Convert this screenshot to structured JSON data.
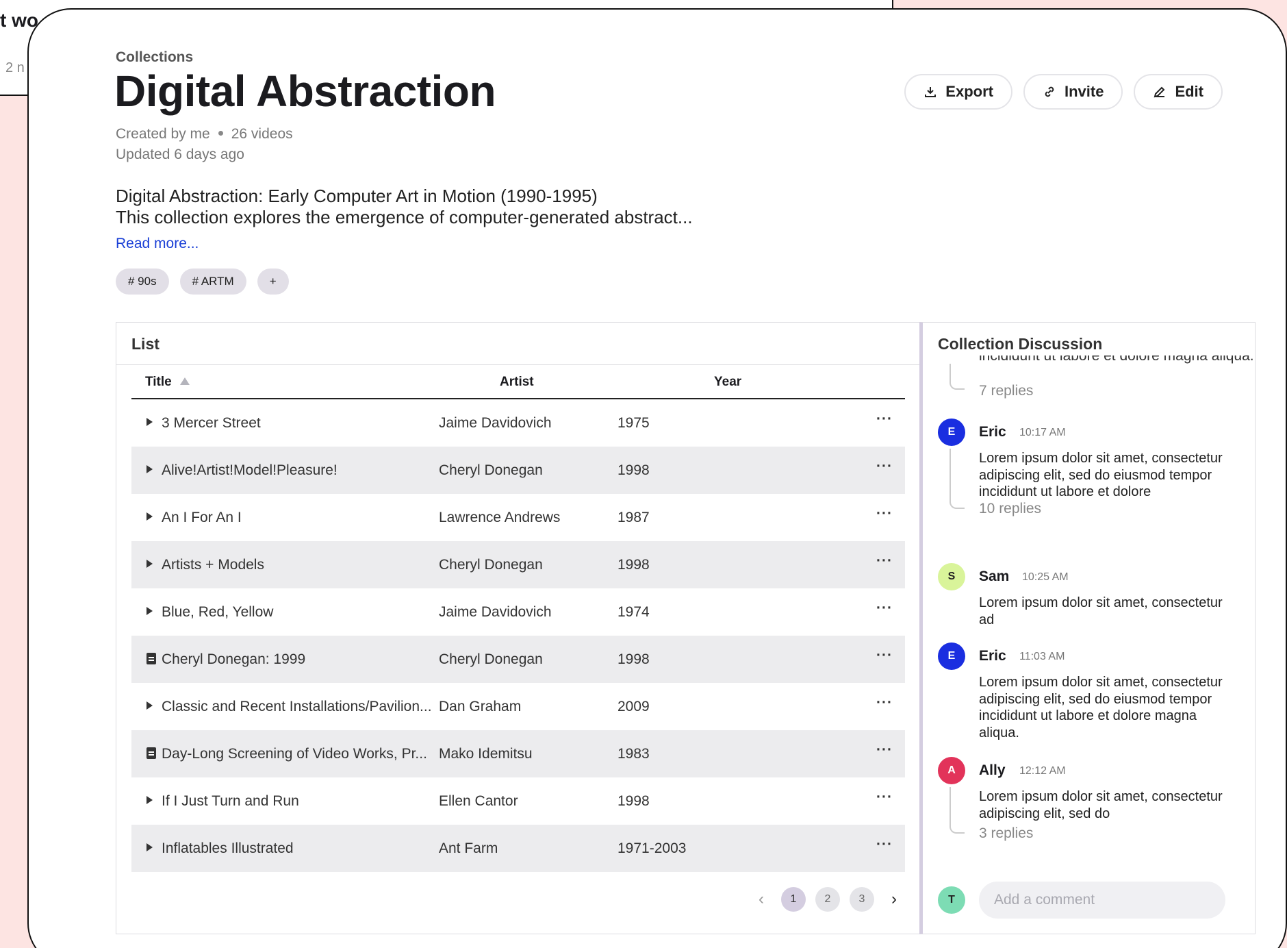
{
  "background": {
    "text1": "t wo",
    "text2": "2 n"
  },
  "breadcrumb": "Collections",
  "title": "Digital Abstraction",
  "meta": {
    "created_by": "Created by me",
    "video_count": "26 videos",
    "updated": "Updated 6 days ago"
  },
  "description": {
    "title": "Digital Abstraction: Early Computer Art in Motion (1990-1995)",
    "body": "This collection explores the emergence of computer-generated abstract...",
    "read_more": "Read more..."
  },
  "tags": [
    "# 90s",
    "# ARTM"
  ],
  "tag_add": "+",
  "actions": {
    "export": "Export",
    "invite": "Invite",
    "edit": "Edit"
  },
  "list": {
    "header": "List",
    "columns": {
      "title": "Title",
      "artist": "Artist",
      "year": "Year"
    },
    "more_label": "···",
    "rows": [
      {
        "title": "3 Mercer Street",
        "artist": "Jaime Davidovich",
        "year": "1975",
        "icon": "play-icon"
      },
      {
        "title": "Alive!Artist!Model!Pleasure!",
        "artist": "Cheryl Donegan",
        "year": "1998",
        "icon": "play-icon"
      },
      {
        "title": "An I For An I",
        "artist": "Lawrence Andrews",
        "year": "1987",
        "icon": "play-icon"
      },
      {
        "title": "Artists + Models",
        "artist": "Cheryl Donegan",
        "year": "1998",
        "icon": "play-icon"
      },
      {
        "title": "Blue, Red, Yellow",
        "artist": "Jaime Davidovich",
        "year": "1974",
        "icon": "play-icon"
      },
      {
        "title": "Cheryl Donegan: 1999",
        "artist": "Cheryl Donegan",
        "year": "1998",
        "icon": "document-icon"
      },
      {
        "title": "Classic and Recent Installations/Pavilion...",
        "artist": "Dan Graham",
        "year": "2009",
        "icon": "play-icon"
      },
      {
        "title": "Day-Long Screening of Video Works, Pr...",
        "artist": "Mako Idemitsu",
        "year": "1983",
        "icon": "document-icon"
      },
      {
        "title": "If I Just Turn and Run",
        "artist": "Ellen Cantor",
        "year": "1998",
        "icon": "play-icon"
      },
      {
        "title": "Inflatables Illustrated",
        "artist": "Ant Farm",
        "year": "1971-2003",
        "icon": "play-icon"
      }
    ]
  },
  "pagination": {
    "prev": "‹",
    "pages": [
      "1",
      "2",
      "3"
    ],
    "current": "1",
    "next": "›"
  },
  "discussion": {
    "header": "Collection Discussion",
    "clipped_text": "incididunt ut labore et dolore magna aliqua.",
    "first_replies": "7 replies",
    "comments": [
      {
        "initial": "E",
        "name": "Eric",
        "time": "10:17 AM",
        "color": "#1a2ee0",
        "body": "Lorem ipsum dolor sit amet, consectetur adipiscing elit, sed do eiusmod tempor incididunt ut labore et dolore",
        "replies": "10 replies"
      },
      {
        "initial": "S",
        "name": "Sam",
        "time": "10:25 AM",
        "color": "#d9f49a",
        "body": "Lorem ipsum dolor sit amet, consectetur ad",
        "replies": ""
      },
      {
        "initial": "E",
        "name": "Eric",
        "time": "11:03 AM",
        "color": "#1a2ee0",
        "body": "Lorem ipsum dolor sit amet, consectetur adipiscing elit, sed do eiusmod tempor incididunt ut labore et dolore magna aliqua.",
        "replies": ""
      },
      {
        "initial": "A",
        "name": "Ally",
        "time": "12:12 AM",
        "color": "#e2335a",
        "body": "Lorem ipsum dolor sit amet, consectetur adipiscing elit, sed do",
        "replies": "3 replies"
      }
    ],
    "current_user": {
      "initial": "T",
      "color": "#7ddcb4"
    },
    "input_placeholder": "Add a comment"
  }
}
